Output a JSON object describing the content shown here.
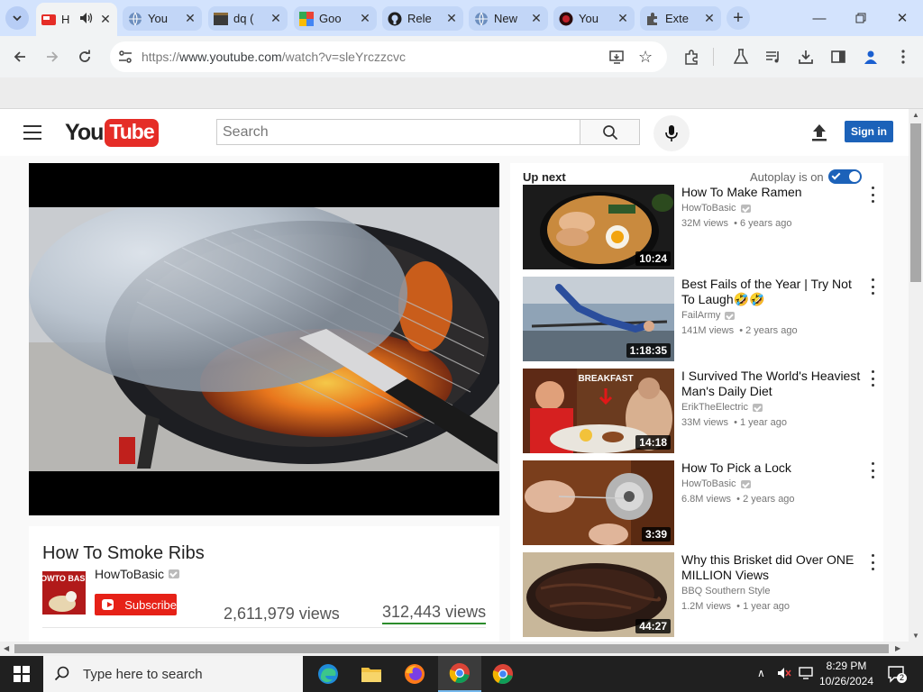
{
  "browser": {
    "tabs": [
      {
        "title": "How To Smoke Ribs - YouTube",
        "short": "H",
        "active": true,
        "icon": "youtube-old-icon"
      },
      {
        "title": "YouTube",
        "short": "You",
        "icon": "globe-icon"
      },
      {
        "title": "dq",
        "short": "dq (",
        "icon": "terminal-icon"
      },
      {
        "title": "Google",
        "short": "Goo",
        "icon": "google-icon"
      },
      {
        "title": "Releases",
        "short": "Rele",
        "icon": "github-icon"
      },
      {
        "title": "New Tab",
        "short": "New",
        "icon": "globe-icon"
      },
      {
        "title": "YouTube",
        "short": "You",
        "icon": "dark-globe-icon"
      },
      {
        "title": "Extensions",
        "short": "Exte",
        "icon": "puzzle-icon"
      }
    ],
    "address": {
      "scheme": "https://",
      "host": "www.youtube.com",
      "path": "/watch?v=sleYrczzcvc"
    }
  },
  "youtube": {
    "search_placeholder": "Search",
    "sign_in": "Sign in",
    "video": {
      "title": "How To Smoke Ribs",
      "channel": "HowToBasic",
      "channel_thumb_text": "HOWTO BASIC",
      "subscribe": "Subscribe",
      "views_left": "2,611,979 views",
      "views_right": "312,443 views"
    },
    "sidebar": {
      "up_next": "Up next",
      "autoplay": "Autoplay is on",
      "autoplay_on": true,
      "items": [
        {
          "title": "How To Make Ramen",
          "channel": "HowToBasic",
          "views": "32M views",
          "age": "6 years ago",
          "duration": "10:24"
        },
        {
          "title": "Best Fails of the Year | Try Not To Laugh🤣🤣",
          "channel": "FailArmy",
          "views": "141M views",
          "age": "2 years ago",
          "duration": "1:18:35"
        },
        {
          "title": "I Survived The World's Heaviest Man's Daily Diet",
          "channel": "ErikTheElectric",
          "views": "33M views",
          "age": "1 year ago",
          "duration": "14:18",
          "thumb_text": "BREAKFAST"
        },
        {
          "title": "How To Pick a Lock",
          "channel": "HowToBasic",
          "views": "6.8M views",
          "age": "2 years ago",
          "duration": "3:39"
        },
        {
          "title": "Why this Brisket did Over ONE MILLION Views",
          "channel": "BBQ Southern Style",
          "views": "1.2M views",
          "age": "1 year ago",
          "duration": "44:27"
        }
      ]
    }
  },
  "taskbar": {
    "search_text": "Type here to search",
    "time": "8:29 PM",
    "date": "10/26/2024",
    "notifications": "2"
  },
  "colors": {
    "tabstrip": "#d3e3fd",
    "youtube_red": "#e62117",
    "signin_blue": "#1c62b9",
    "views_underline": "#2b8c2b"
  }
}
